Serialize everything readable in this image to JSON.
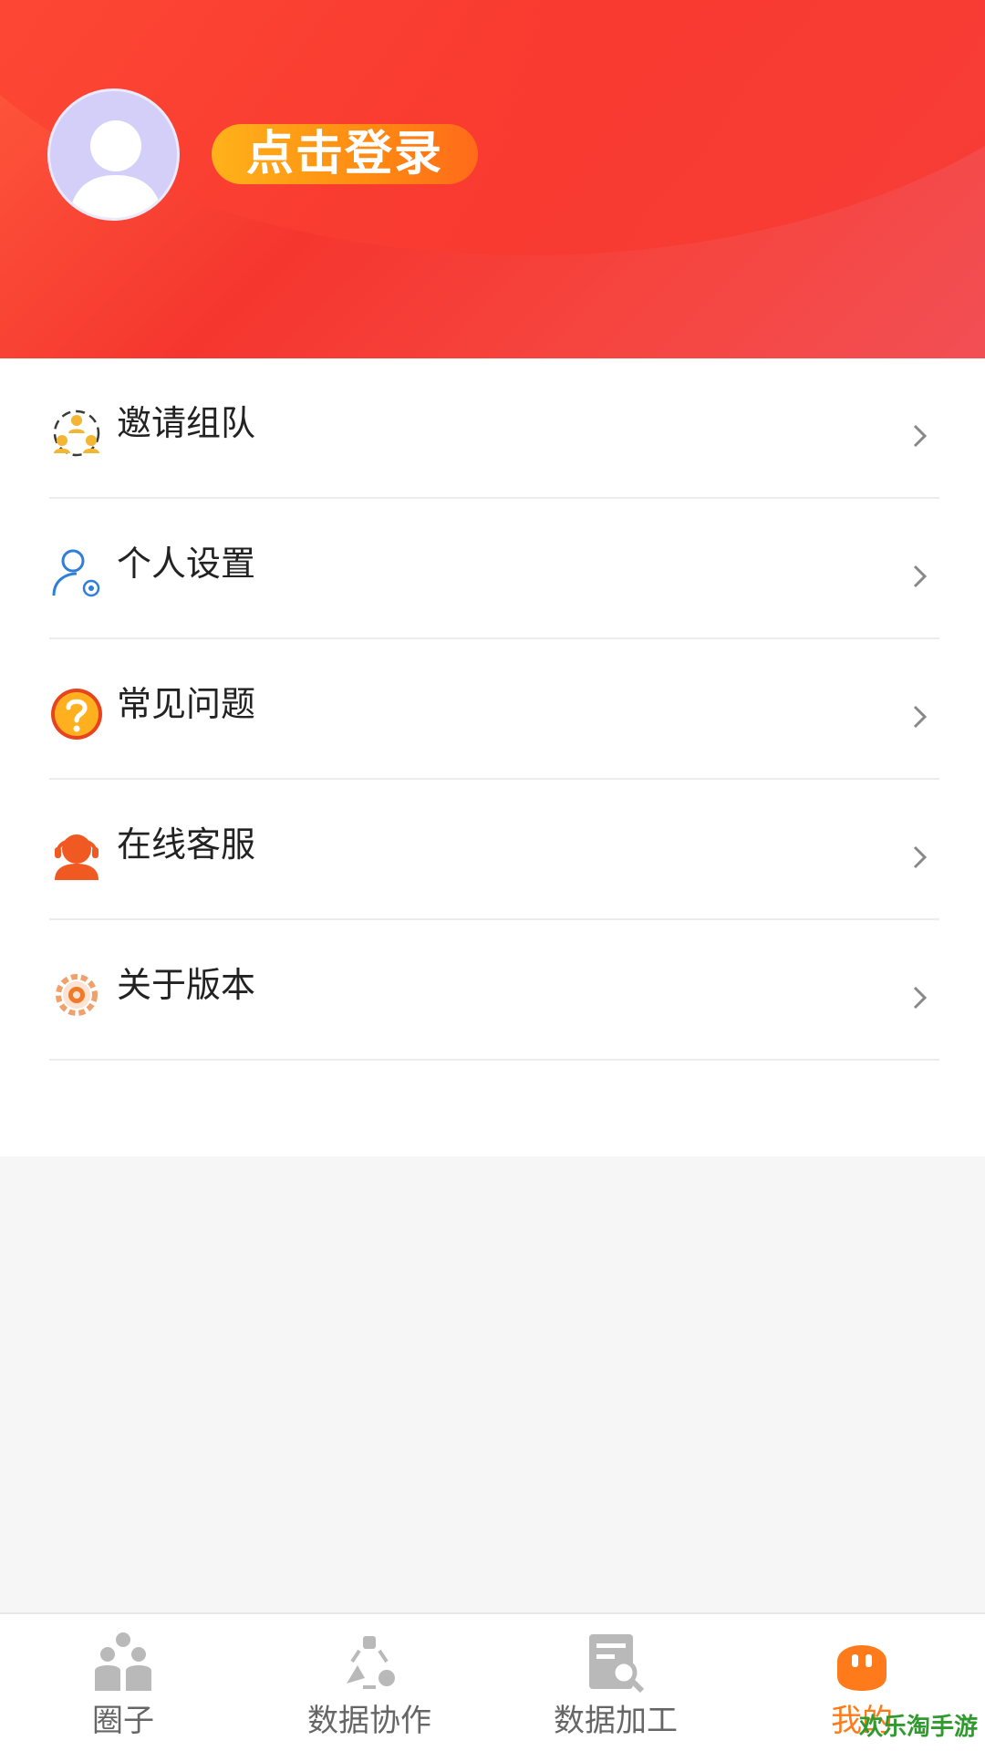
{
  "header": {
    "login_label": "点击登录"
  },
  "menu": {
    "items": [
      {
        "label": "邀请组队",
        "icon": "team-invite-icon"
      },
      {
        "label": "个人设置",
        "icon": "user-settings-icon"
      },
      {
        "label": "常见问题",
        "icon": "question-icon"
      },
      {
        "label": "在线客服",
        "icon": "customer-service-icon"
      },
      {
        "label": "关于版本",
        "icon": "gear-icon"
      }
    ]
  },
  "tabbar": {
    "tabs": [
      {
        "label": "圈子",
        "icon": "circle-group-icon"
      },
      {
        "label": "数据协作",
        "icon": "collaboration-icon"
      },
      {
        "label": "数据加工",
        "icon": "data-processing-icon"
      },
      {
        "label": "我的",
        "icon": "mine-icon",
        "active": true
      }
    ]
  },
  "watermark": "欢乐淘手游",
  "colors": {
    "header": "#f5362f",
    "accent": "#ff7a1a",
    "login_button": "#ff9a14"
  }
}
